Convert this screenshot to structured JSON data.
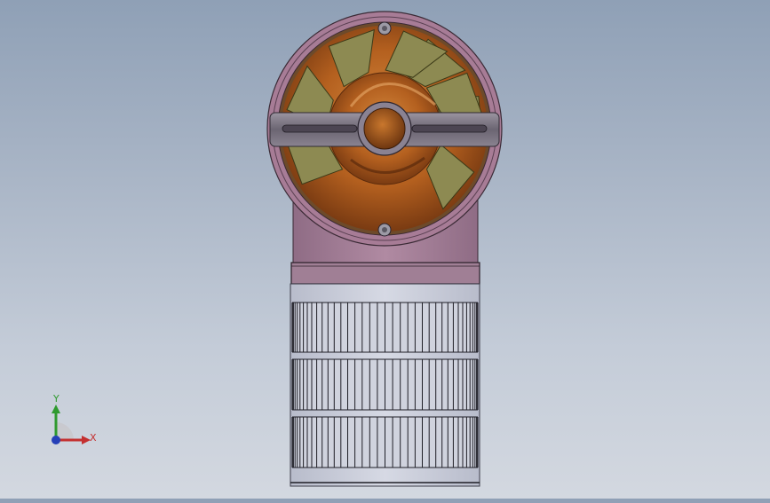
{
  "viewport": {
    "background_top": "#8fa0b6",
    "background_bottom": "#d3d8e0"
  },
  "model": {
    "description_icon": "fan-motor-assembly-front-view",
    "colors": {
      "housing_rim": "#a77c96",
      "impeller_copper": "#b65f1e",
      "blade_olive": "#8d8a52",
      "strut_grey": "#7d7682",
      "body_mauve": "#9c7890",
      "heatsink_light": "#c9ccd9",
      "fin_dark": "#1e1e26"
    }
  },
  "triad": {
    "y_label": "Y",
    "x_label": "X",
    "y_color": "#2f9a2f",
    "x_color": "#c43030",
    "z_color": "#2540b8"
  }
}
